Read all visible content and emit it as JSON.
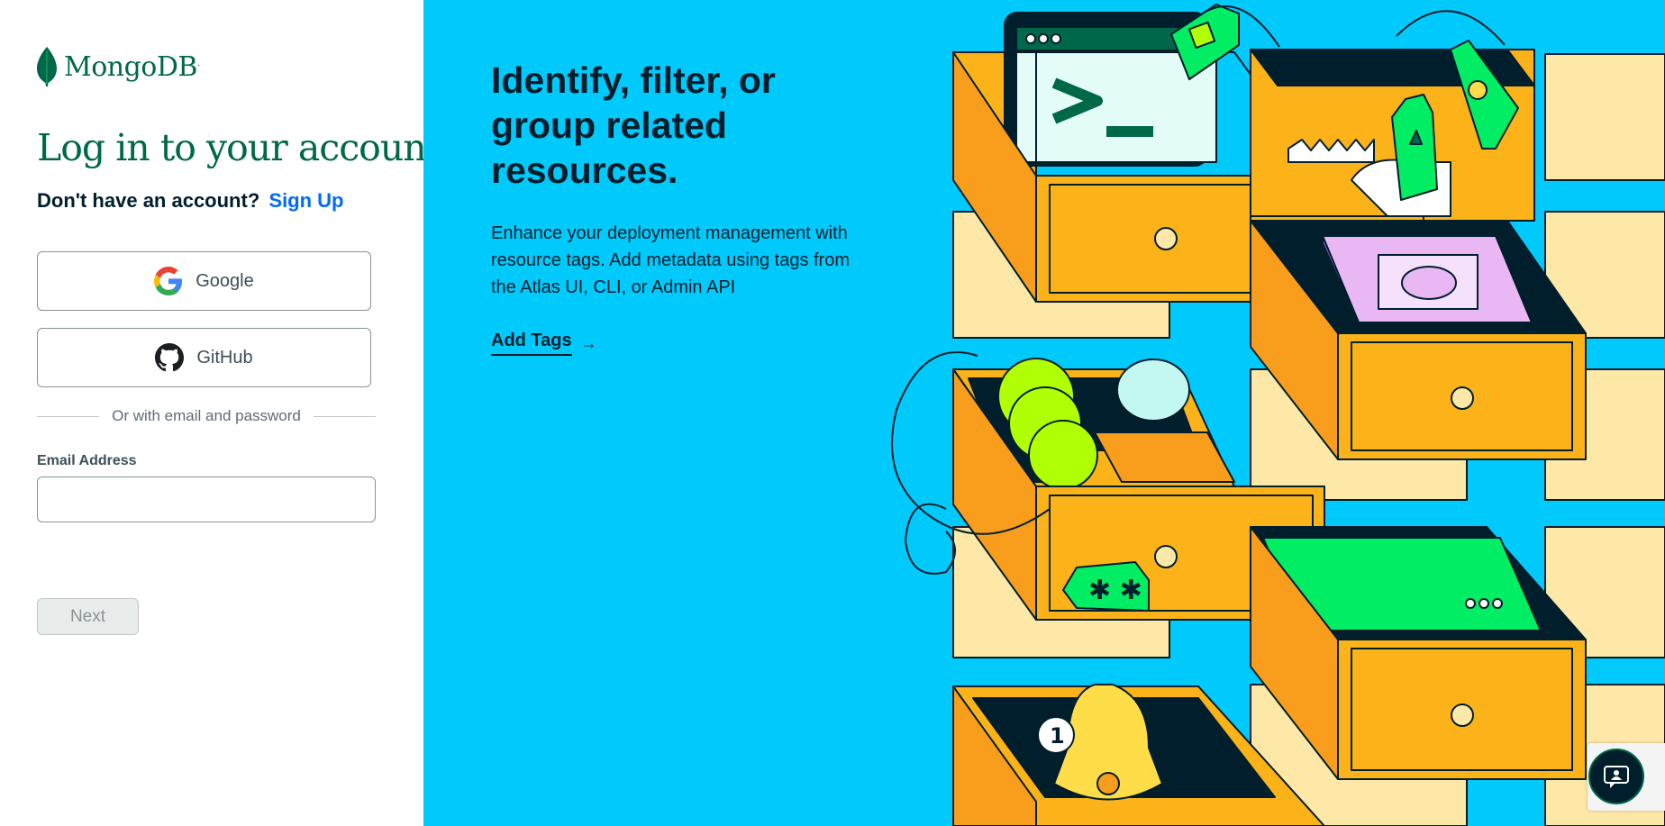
{
  "brand": {
    "name": "MongoDB",
    "trademark": ".",
    "icon": "leaf-icon"
  },
  "login": {
    "title": "Log in to your account",
    "signup_prompt": "Don't have an account?",
    "signup_link": "Sign Up",
    "google_label": "Google",
    "github_label": "GitHub",
    "divider_text": "Or with email and password",
    "email_label": "Email Address",
    "email_value": "",
    "next_label": "Next"
  },
  "promo": {
    "title": "Identify, filter, or group related resources.",
    "description": "Enhance your deployment management with resource tags. Add metadata using tags from the Atlas UI, CLI, or Admin API",
    "link_label": "Add Tags",
    "link_arrow": "→",
    "illustration": "drawers-with-tags-illustration",
    "notification_count": "1"
  },
  "colors": {
    "brand_green": "#00684a",
    "link_blue": "#016bf8",
    "promo_bg": "#00c9fb",
    "drawer_orange": "#fbb319",
    "drawer_light": "#fde8a8",
    "tag_green": "#00ed64"
  },
  "chat": {
    "icon": "chat-support-icon"
  }
}
